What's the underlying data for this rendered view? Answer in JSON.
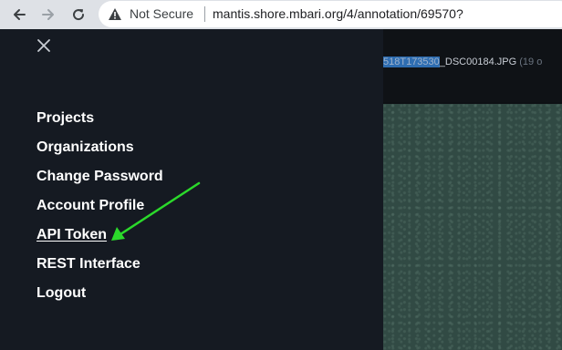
{
  "browser": {
    "security_label": "Not Secure",
    "url": "mantis.shore.mbari.org/4/annotation/69570?",
    "icons": [
      "back-arrow-icon",
      "forward-arrow-icon",
      "reload-icon",
      "warning-icon"
    ]
  },
  "viewer": {
    "title_selected": "518T173530",
    "title_rest": "_DSC00184.JPG",
    "title_count": "(19 o"
  },
  "menu": {
    "close_icon": "close-icon",
    "items": [
      {
        "label": "Projects"
      },
      {
        "label": "Organizations"
      },
      {
        "label": "Change Password"
      },
      {
        "label": "Account Profile"
      },
      {
        "label": "API Token"
      },
      {
        "label": "REST Interface"
      },
      {
        "label": "Logout"
      }
    ]
  },
  "colors": {
    "menu_bg": "#151a22",
    "annotation_arrow": "#2bd92b"
  }
}
